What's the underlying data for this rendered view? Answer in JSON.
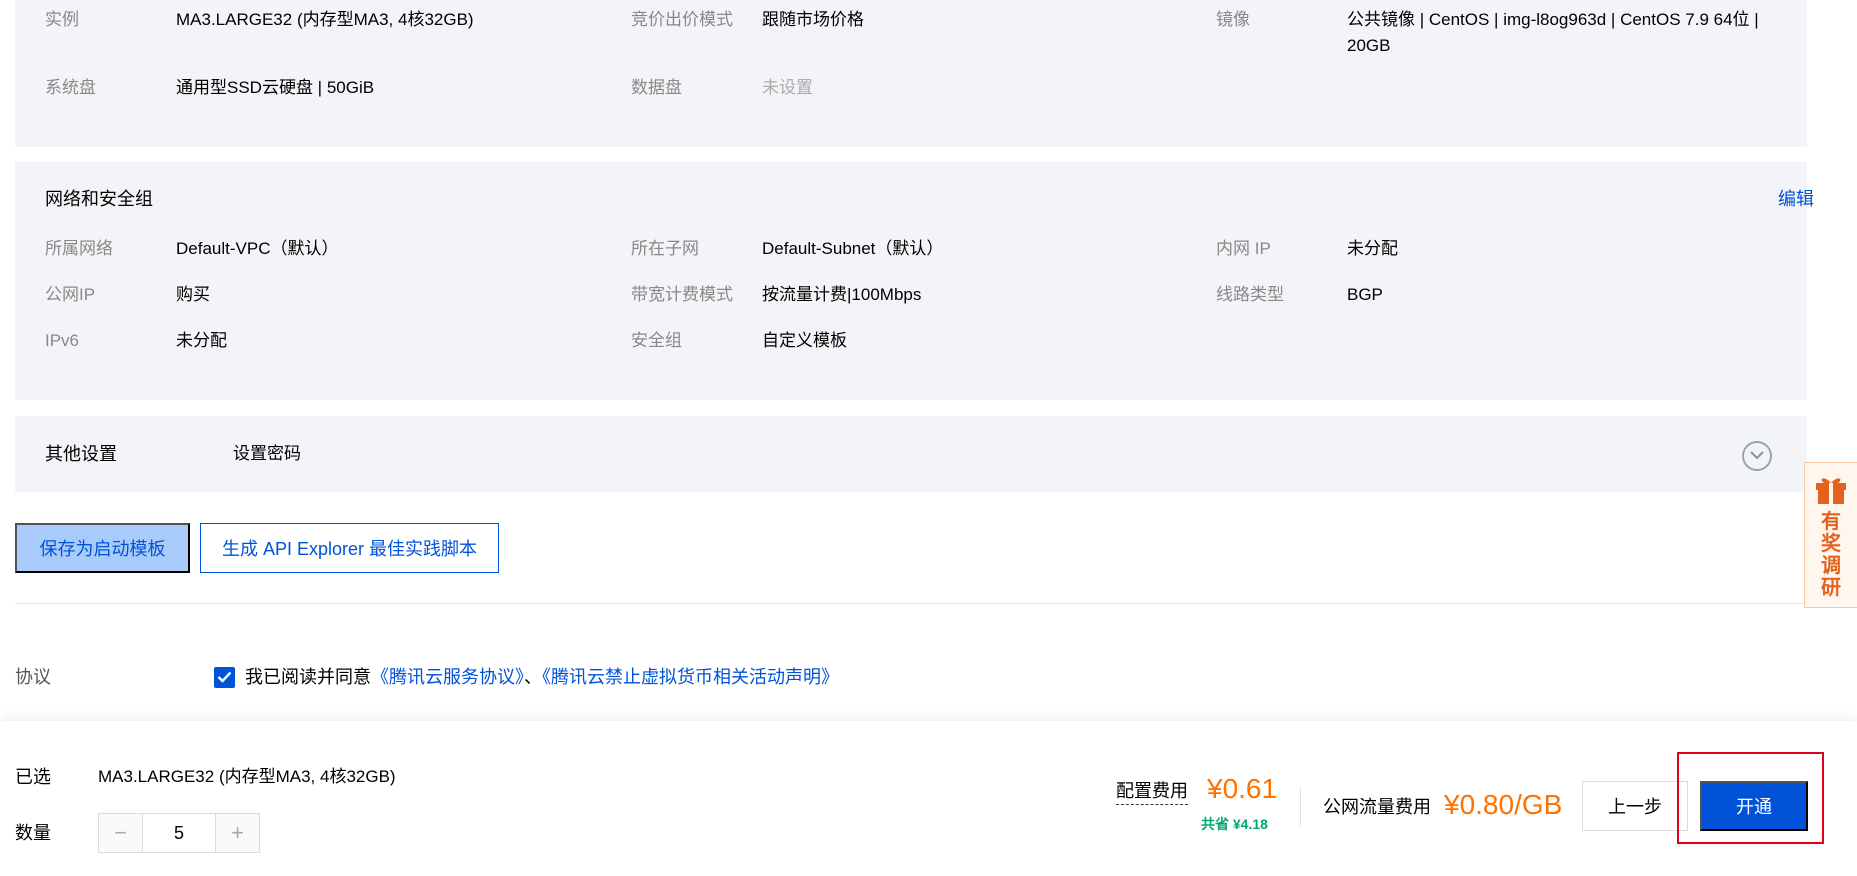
{
  "config": {
    "instance_label": "实例",
    "instance_value": "MA3.LARGE32 (内存型MA3, 4核32GB)",
    "bidding_label": "竞价出价模式",
    "bidding_value": "跟随市场价格",
    "image_label": "镜像",
    "image_value": "公共镜像 | CentOS | img-l8og963d | CentOS 7.9 64位 | 20GB",
    "system_disk_label": "系统盘",
    "system_disk_value": "通用型SSD云硬盘 | 50GiB",
    "data_disk_label": "数据盘",
    "data_disk_value": "未设置"
  },
  "network": {
    "title": "网络和安全组",
    "edit_label": "编辑",
    "vpc_label": "所属网络",
    "vpc_value": "Default-VPC（默认）",
    "subnet_label": "所在子网",
    "subnet_value": "Default-Subnet（默认）",
    "private_ip_label": "内网 IP",
    "private_ip_value": "未分配",
    "public_ip_label": "公网IP",
    "public_ip_value": "购买",
    "bandwidth_label": "带宽计费模式",
    "bandwidth_value": "按流量计费|100Mbps",
    "line_label": "线路类型",
    "line_value": "BGP",
    "ipv6_label": "IPv6",
    "ipv6_value": "未分配",
    "security_group_label": "安全组",
    "security_group_value": "自定义模板"
  },
  "other": {
    "title": "其他设置",
    "value": "设置密码",
    "expand_icon": "chevron-down-circle-icon"
  },
  "actions": {
    "save_template": "保存为启动模板",
    "api_explorer": "生成 API Explorer 最佳实践脚本"
  },
  "agreement": {
    "label": "协议",
    "checked": true,
    "prefix": "我已阅读并同意",
    "link1": "《腾讯云服务协议》",
    "separator": "、",
    "link2": "《腾讯云禁止虚拟货币相关活动声明》"
  },
  "footer": {
    "selected_label": "已选",
    "selected_value": "MA3.LARGE32 (内存型MA3, 4核32GB)",
    "quantity_label": "数量",
    "quantity_minus": "−",
    "quantity_value": "5",
    "quantity_plus": "+",
    "config_fee_label": "配置费用",
    "config_fee_value": "¥0.61",
    "saving_note": "共省 ¥4.18",
    "traffic_fee_label": "公网流量费用",
    "traffic_fee_value": "¥0.80/GB",
    "prev_button": "上一步",
    "open_button": "开通"
  },
  "survey": {
    "icon": "gift-icon",
    "text": "有奖调研"
  },
  "colors": {
    "accent": "#0052d9",
    "price": "#ff7200",
    "saving": "#00a870",
    "highlight": "#e0001b"
  }
}
